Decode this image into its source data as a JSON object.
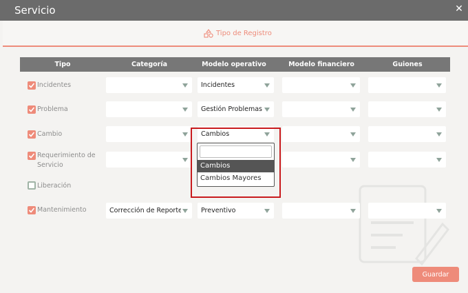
{
  "window": {
    "title": "Servicio",
    "close_glyph": "✕"
  },
  "tab": {
    "label": "Tipo de Registro",
    "icon": "shapes-icon"
  },
  "table": {
    "headers": [
      "Tipo",
      "Categoría",
      "Modelo operativo",
      "Modelo financiero",
      "Guiones"
    ],
    "rows": [
      {
        "label": "Incidentes",
        "checked": true,
        "categoria": "",
        "modelo_operativo": "Incidentes",
        "modelo_financiero": "",
        "guiones": ""
      },
      {
        "label": "Problema",
        "checked": true,
        "categoria": "",
        "modelo_operativo": "Gestión Problemas",
        "modelo_financiero": "",
        "guiones": ""
      },
      {
        "label": "Cambio",
        "checked": true,
        "categoria": "",
        "modelo_operativo": "Cambios",
        "modelo_financiero": "",
        "guiones": ""
      },
      {
        "label_line1": "Requerimiento de",
        "label_line2": "Servicio",
        "checked": true,
        "categoria": "",
        "modelo_operativo": "",
        "modelo_financiero": "",
        "guiones": ""
      },
      {
        "label": "Liberación",
        "checked": false
      },
      {
        "label": "Mantenimiento",
        "checked": true,
        "categoria": "Corrección de Reporte",
        "modelo_operativo": "Preventivo",
        "modelo_financiero": "",
        "guiones": ""
      }
    ]
  },
  "dropdown": {
    "search_value": "",
    "options": [
      "Cambios",
      "Cambios Mayores"
    ],
    "highlighted": "Cambios"
  },
  "footer": {
    "save_label": "Guardar"
  },
  "colors": {
    "accent": "#ee8b7a",
    "titlebar": "#6b6b6b",
    "header": "#777777",
    "highlight_border": "#c8191c"
  }
}
